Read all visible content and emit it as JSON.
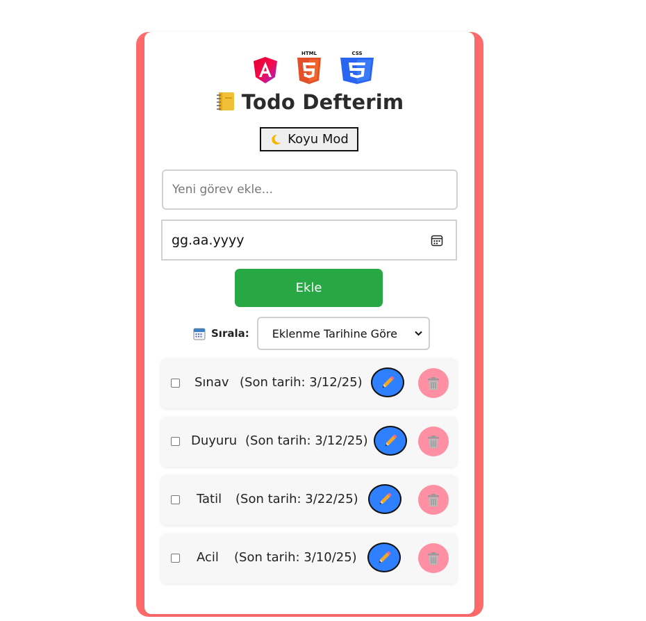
{
  "app": {
    "title": "Todo Defterim",
    "dark_mode_label": "Koyu Mod",
    "logos": [
      "angular-logo",
      "html5-logo",
      "css3-logo"
    ],
    "logo_texts": {
      "html": "HTML",
      "css": "CSS"
    }
  },
  "form": {
    "task_placeholder": "Yeni görev ekle...",
    "date_value": "gg.aa.yyyy",
    "add_label": "Ekle"
  },
  "sort": {
    "label": "Sırala:",
    "selected": "Eklenme Tarihine Göre"
  },
  "todos": [
    {
      "name": "Sınav",
      "due": "(Son tarih: 3/12/25)",
      "checked": false
    },
    {
      "name": "Duyuru",
      "due": "(Son tarih: 3/12/25)",
      "checked": false
    },
    {
      "name": "Tatil",
      "due": "(Son tarih: 3/22/25)",
      "checked": false
    },
    {
      "name": "Acil",
      "due": "(Son tarih: 3/10/25)",
      "checked": false
    }
  ],
  "colors": {
    "card_border": "#ff6b6b",
    "add_button": "#28a745",
    "edit_button": "#2f80ff",
    "delete_button": "#ff8fa3"
  },
  "icons": {
    "title": "notebook-icon",
    "dark_mode": "moon-icon",
    "sort": "calendar-icon",
    "edit": "pencil-icon",
    "delete": "trash-icon",
    "date": "calendar-picker-icon"
  }
}
